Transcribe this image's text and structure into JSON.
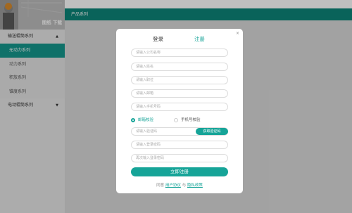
{
  "banner": {
    "text": "图纸 下载"
  },
  "sidebar": {
    "categories": [
      {
        "label": "输送辊筒系列",
        "arrow": "▲"
      },
      {
        "label": "电动辊筒系列",
        "arrow": "▼"
      }
    ],
    "items": [
      {
        "label": "无动力系列"
      },
      {
        "label": "动力系列"
      },
      {
        "label": "积放系列"
      },
      {
        "label": "锥度系列"
      }
    ]
  },
  "header": {
    "title": "产品系列"
  },
  "modal": {
    "close": "×",
    "tab_login": "登录",
    "tab_register": "注册",
    "fields": {
      "company": "请输入公司名称",
      "name": "请输入姓名",
      "position": "请输入职位",
      "email": "请输入邮箱",
      "phone": "请输入手机号码",
      "code": "请输入验证码",
      "password": "请输入登录密码",
      "password_confirm": "再次输入登录密码"
    },
    "verify_email": "邮箱校验",
    "verify_phone": "手机号校验",
    "get_code": "获取验证码",
    "submit": "立即注册",
    "agree_prefix": "同意",
    "user_agreement": "用户协议",
    "agree_and": "与",
    "privacy_policy": "隐私政策"
  },
  "colors": {
    "accent": "#16a498",
    "topbar": "#0d8478",
    "active_item": "#15978c"
  }
}
